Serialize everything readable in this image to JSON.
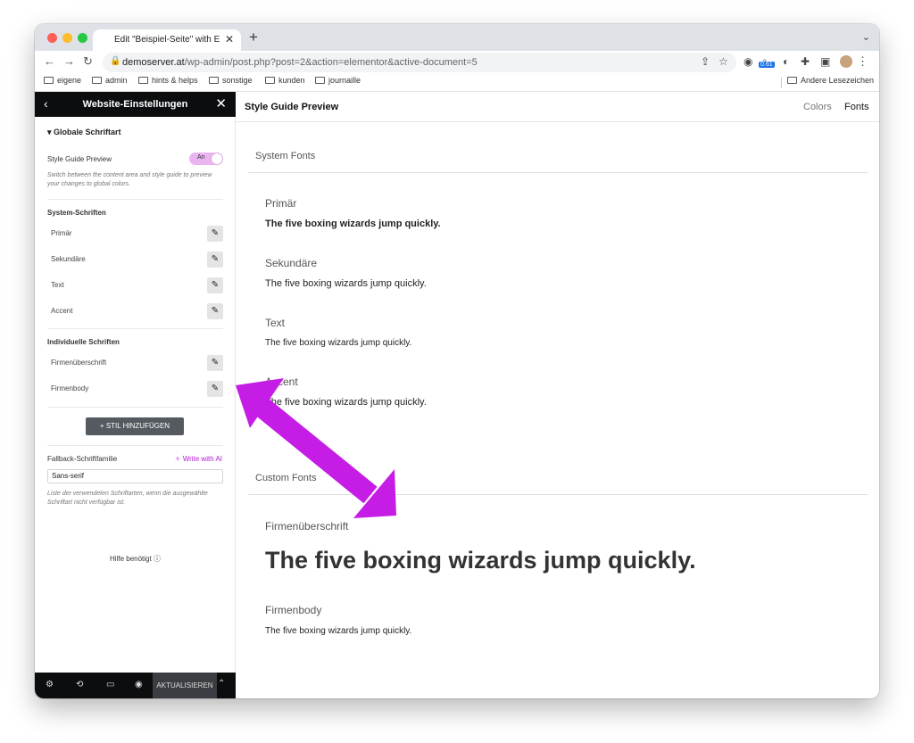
{
  "browser": {
    "tab_title": "Edit \"Beispiel-Seite\" with Elem",
    "url_host": "demoserver.at",
    "url_path": "/wp-admin/post.php?post=2&action=elementor&active-document=5",
    "badge_value": "0.61",
    "bookmarks": [
      "eigene",
      "admin",
      "hints & helps",
      "sonstige",
      "kunden",
      "journaille"
    ],
    "other_bookmarks": "Andere Lesezeichen"
  },
  "sidebar": {
    "title": "Website-Einstellungen",
    "section": "Globale Schriftart",
    "style_guide_label": "Style Guide Preview",
    "toggle_text": "An",
    "style_guide_help": "Switch between the content area and style guide to preview your changes to global colors.",
    "system_heading": "System-Schriften",
    "system_fonts": [
      "Primär",
      "Sekundäre",
      "Text",
      "Accent"
    ],
    "custom_heading": "Individuelle Schriften",
    "custom_fonts": [
      "Firmenüberschrift",
      "Firmenbody"
    ],
    "add_style_button": "+ STIL HINZUFÜGEN",
    "fallback_label": "Fallback-Schriftfamilie",
    "write_ai": "Write with AI",
    "fallback_value": "Sans-serif",
    "fallback_help": "Liste der verwendeten Schriftarten, wenn die ausgewählte Schriftart nicht verfügbar ist.",
    "help_label": "Hilfe benötigt",
    "footer_update": "AKTUALISIEREN"
  },
  "preview": {
    "title": "Style Guide Preview",
    "tabs": [
      "Colors",
      "Fonts"
    ],
    "active_tab": "Fonts",
    "system_section": "System Fonts",
    "custom_section": "Custom Fonts",
    "sample_text": "The five boxing wizards jump quickly.",
    "system_fonts": [
      "Primär",
      "Sekundäre",
      "Text",
      "Accent"
    ],
    "custom_fonts": [
      "Firmenüberschrift",
      "Firmenbody"
    ]
  },
  "colors": {
    "arrow": "#c51de6",
    "toggle": "#e9b4f0",
    "sidebar_dark": "#0c0d0e"
  }
}
